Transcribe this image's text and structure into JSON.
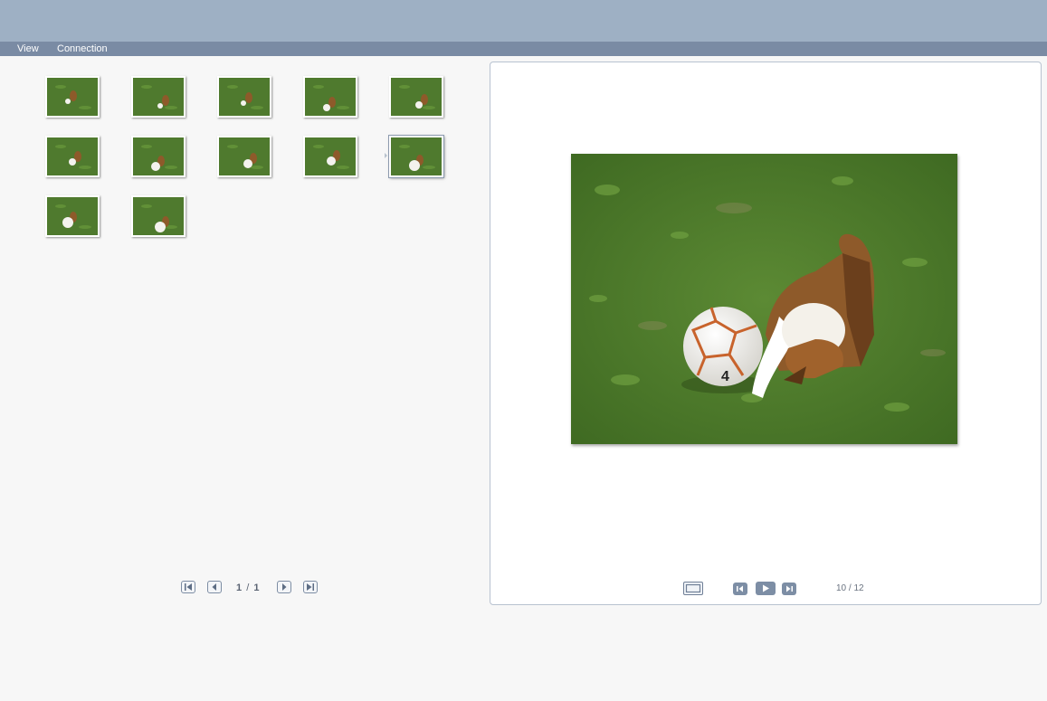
{
  "menu": {
    "items": [
      "View",
      "Connection"
    ]
  },
  "gallery": {
    "thumbnail_count": 12,
    "selected_index": 10,
    "pager": {
      "current": "1",
      "separator": "/",
      "total": "1"
    }
  },
  "viewer": {
    "counter": "10 / 12",
    "photo": {
      "subject": "puppy with soccer ball on grass",
      "ball_number": "4"
    }
  },
  "colors": {
    "top_band": "#9eb0c4",
    "menu_bar": "#7a8ba4",
    "control_fill": "#7d8ea5",
    "grass": "#4f7a2e"
  },
  "icons": [
    "first-page-icon",
    "prev-page-icon",
    "next-page-icon",
    "last-page-icon",
    "fit-screen-icon",
    "prev-image-icon",
    "play-icon",
    "next-image-icon"
  ]
}
